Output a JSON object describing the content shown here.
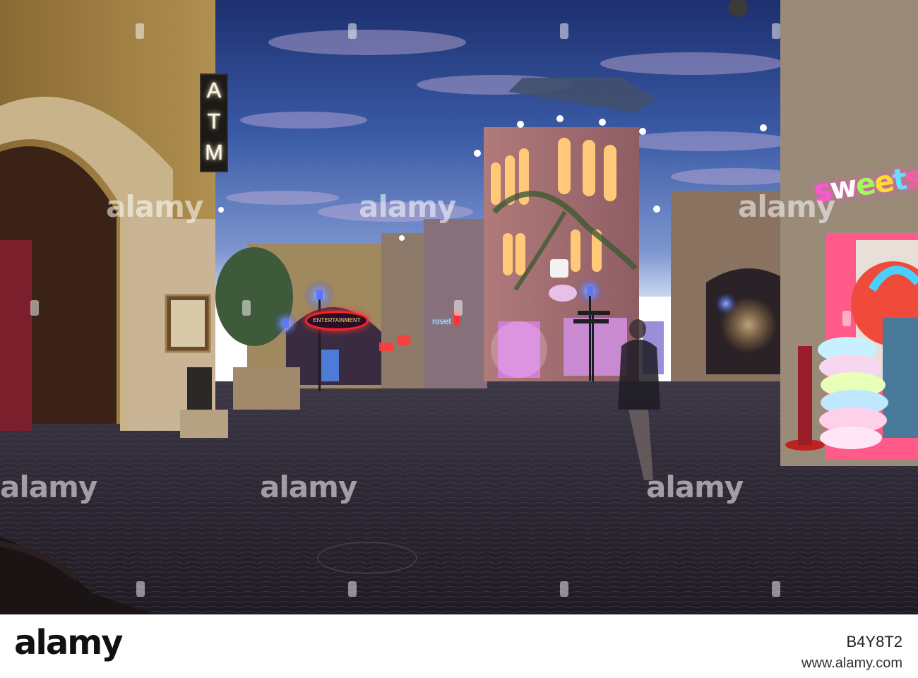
{
  "scene": {
    "description_tags": [
      "indoor-piazza",
      "painted-sky-ceiling",
      "cobblestone-square"
    ],
    "signs": {
      "atm": "ATM",
      "sweets": [
        "s",
        "w",
        "e",
        "e",
        "t",
        "s"
      ],
      "entertainment": "ENTERTAINMENT",
      "rovet": "rovet"
    }
  },
  "watermark": {
    "text": "alamy"
  },
  "footer": {
    "logo": "alamy",
    "image_id": "B4Y8T2",
    "website": "www.alamy.com"
  }
}
